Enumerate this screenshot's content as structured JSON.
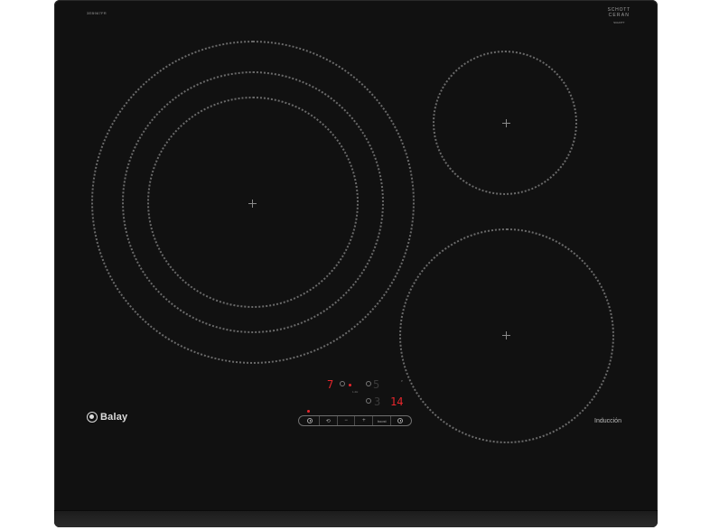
{
  "product": {
    "model_code": "3EB967FR",
    "glass_brand_line1": "SCHOTT",
    "glass_brand_line2": "CERAN",
    "glass_brand_line3": "SCHOTT",
    "brand_name": "Balay",
    "type_label": "Inducción"
  },
  "display": {
    "left_digit": "7",
    "top_right_digit": "5",
    "bottom_left_digit": "3",
    "bottom_right_digits": "14",
    "tiny_left": "1.2H",
    "tiny_right": "P"
  },
  "touch_bar": {
    "keys": [
      {
        "icon": "clock-icon",
        "label": ""
      },
      {
        "icon": "power-icon",
        "label": "⟲"
      },
      {
        "icon": "minus-icon",
        "label": "−"
      },
      {
        "icon": "plus-icon",
        "label": "+"
      },
      {
        "icon": "boost-icon",
        "label": "boost"
      },
      {
        "icon": "timer-icon",
        "label": ""
      }
    ]
  },
  "colors": {
    "glass": "#111111",
    "zone_print": "#6a6a6a",
    "led_red": "#e8262c",
    "background": "#ffffff"
  }
}
